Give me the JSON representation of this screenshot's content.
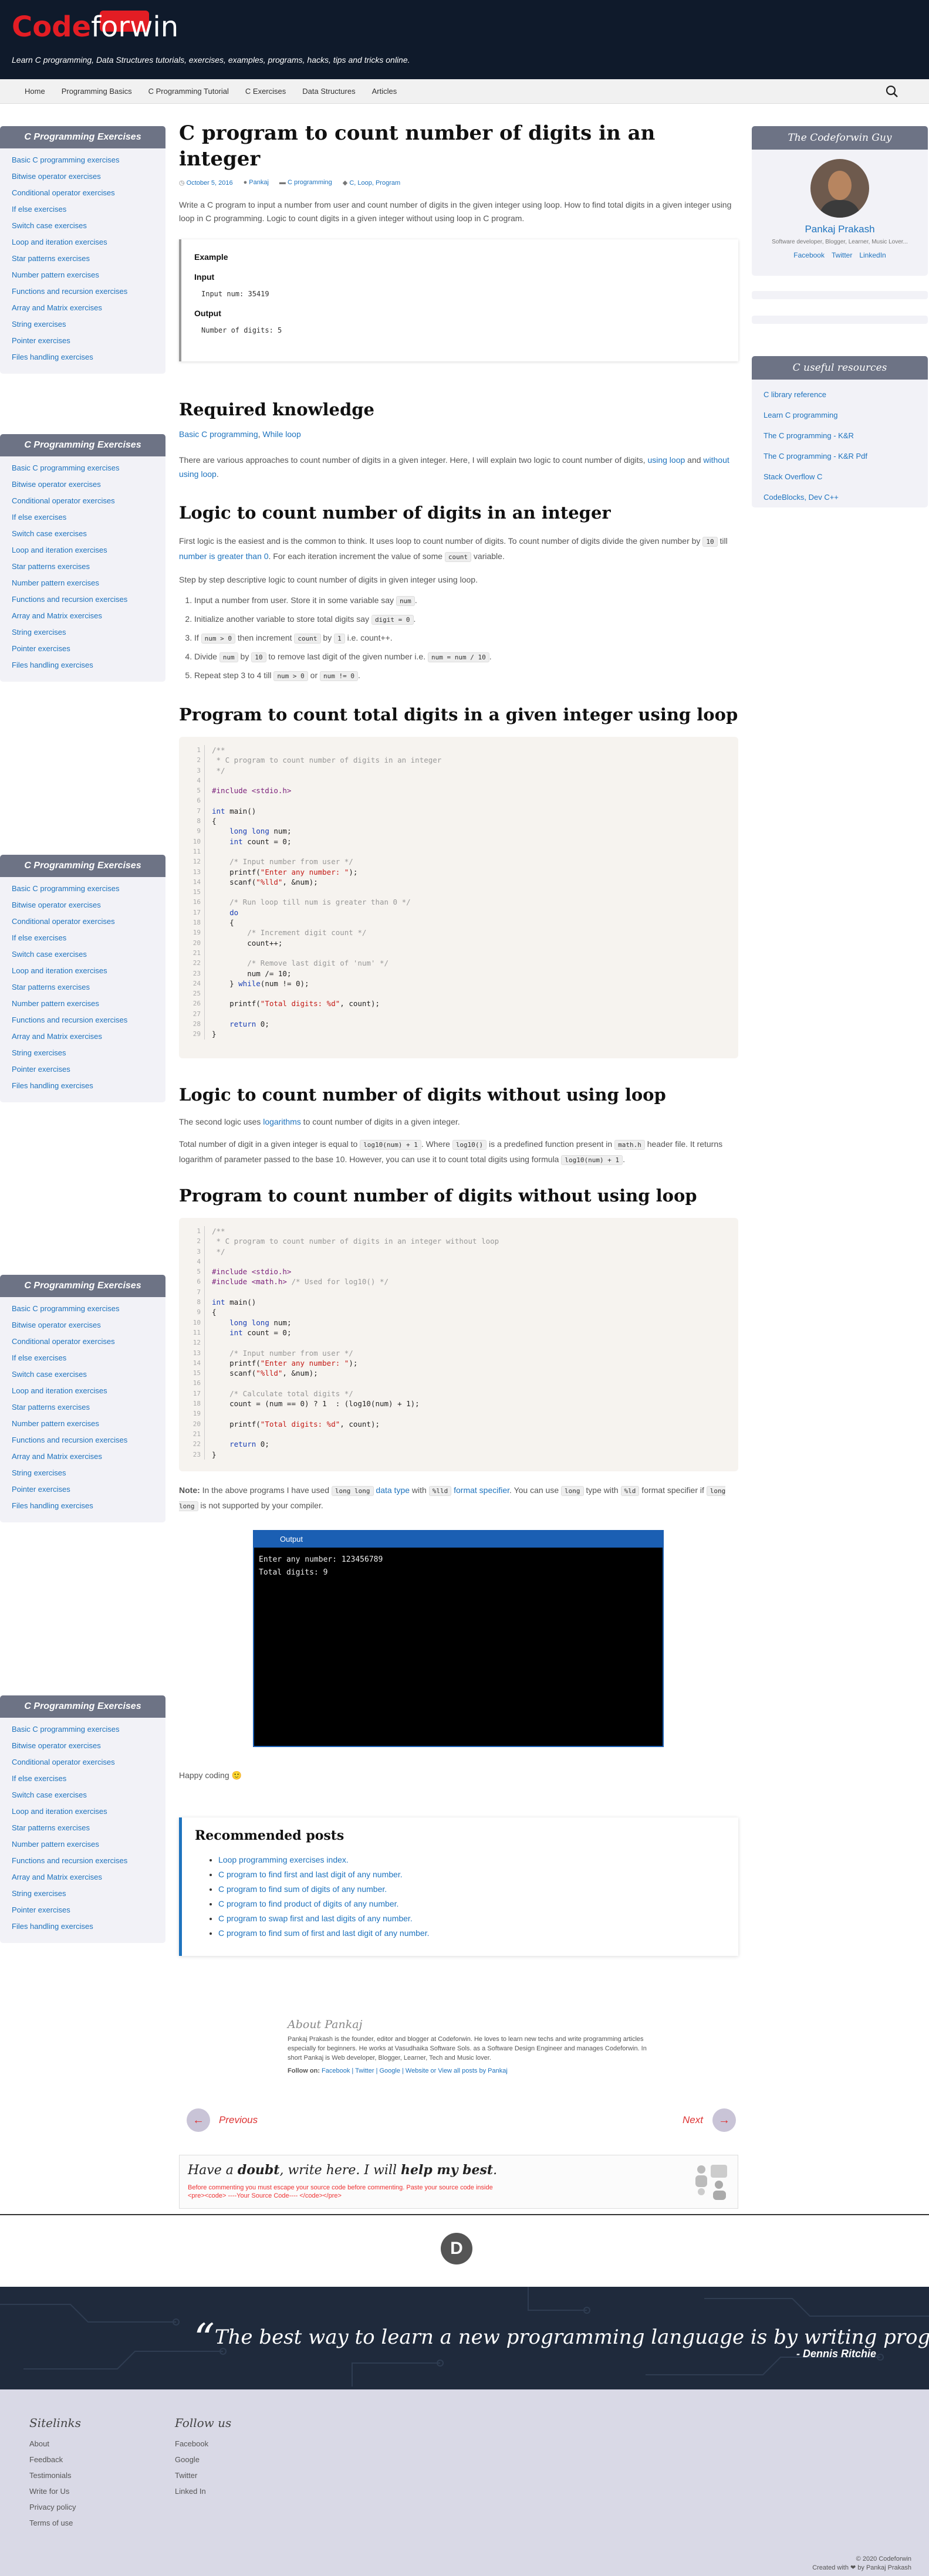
{
  "site": {
    "logo_a": "Code",
    "logo_b": "forwin",
    "tagline": "Learn C programming, Data Structures tutorials, exercises, examples, programs, hacks, tips and tricks online."
  },
  "nav": [
    "Home",
    "Programming Basics",
    "C Programming Tutorial",
    "C Exercises",
    "Data Structures",
    "Articles"
  ],
  "left_sidebar": {
    "title": "C Programming Exercises",
    "items": [
      "Basic C programming exercises",
      "Bitwise operator exercises",
      "Conditional operator exercises",
      "If else exercises",
      "Switch case exercises",
      "Loop and iteration exercises",
      "Star patterns exercises",
      "Number pattern exercises",
      "Functions and recursion exercises",
      "Array and Matrix exercises",
      "String exercises",
      "Pointer exercises",
      "Files handling exercises"
    ]
  },
  "right_sidebar": {
    "profile_title": "The Codeforwin Guy",
    "name": "Pankaj Prakash",
    "desc": "Software developer, Blogger, Learner, Music Lover...",
    "social": [
      "Facebook",
      "Twitter",
      "LinkedIn"
    ],
    "resources_title": "C useful resources",
    "resources": [
      "C library reference",
      "Learn C programming",
      "The C programming - K&R",
      "The C programming - K&R Pdf",
      "Stack Overflow C",
      "CodeBlocks, Dev C++"
    ]
  },
  "article": {
    "title": "C program to count number of digits in an integer",
    "date": "October 5, 2016",
    "author": "Pankaj",
    "category": "C programming",
    "tags": "C, Loop, Program",
    "intro": "Write a C program to input a number from user and count number of digits in the given integer using loop. How to find total digits in a given integer using loop in C programming. Logic to count digits in a given integer without using loop in C program.",
    "example": {
      "label": "Example",
      "input_label": "Input",
      "input": "Input num: 35419",
      "output_label": "Output",
      "output": "Number of digits: 5"
    },
    "req_title": "Required knowledge",
    "req_links": [
      "Basic C programming",
      "While loop"
    ],
    "approach": "There are various approaches to count number of digits in a given integer. Here, I will explain two logic to count number of digits, ",
    "approach_l1": "using loop",
    "approach_mid": " and ",
    "approach_l2": "without using loop",
    "approach_end": ".",
    "logic1_title": "Logic to count number of digits in an integer",
    "logic1_p1": "First logic is the easiest and is the common to think. It uses loop to count number of digits. To count number of digits divide the given number by ",
    "logic1_c1": "10",
    "logic1_p2": " till ",
    "logic1_l1": "number is greater than 0",
    "logic1_p3": ". For each iteration increment the value of some ",
    "logic1_c2": "count",
    "logic1_p4": " variable.",
    "logic1_steps_intro": "Step by step descriptive logic to count number of digits in given integer using loop.",
    "steps": [
      {
        "a": "Input a number from user. Store it in some variable say ",
        "c1": "num",
        "b": ".",
        "c2": "",
        "d": "",
        "c3": "",
        "e": ""
      },
      {
        "a": "Initialize another variable to store total digits say ",
        "c1": "digit = 0",
        "b": ".",
        "c2": "",
        "d": "",
        "c3": "",
        "e": ""
      },
      {
        "a": "If ",
        "c1": "num > 0",
        "b": " then increment ",
        "c2": "count",
        "d": " by ",
        "c3": "1",
        "e": " i.e. count++."
      },
      {
        "a": "Divide ",
        "c1": "num",
        "b": " by ",
        "c2": "10",
        "d": " to remove last digit of the given number i.e. ",
        "c3": "num = num / 10",
        "e": "."
      },
      {
        "a": "Repeat step 3 to 4 till ",
        "c1": "num > 0",
        "b": " or ",
        "c2": "num != 0",
        "d": ".",
        "c3": "",
        "e": ""
      }
    ],
    "prog1_title": "Program to count total digits in a given integer using loop",
    "logic2_title": "Logic to count number of digits without using loop",
    "logic2_p1a": "The second logic uses ",
    "logic2_l": "logarithms",
    "logic2_p1b": " to count number of digits in a given integer.",
    "logic2_p2a": "Total number of digit in a given integer is equal to ",
    "logic2_c1": "log10(num) + 1",
    "logic2_p2b": ". Where ",
    "logic2_c2": "log10()",
    "logic2_p2c": " is a predefined function present in ",
    "logic2_c3": "math.h",
    "logic2_p2d": " header file. It returns logarithm of parameter passed to the base 10. However, you can use it to count total digits using formula ",
    "logic2_c4": "log10(num) + 1",
    "logic2_p2e": ".",
    "prog2_title": "Program to count number of digits without using loop",
    "note_label": "Note:",
    "note_a": " In the above programs I have used ",
    "note_c1": "long long",
    "note_l1": "data type",
    "note_b": " with ",
    "note_c2": "%lld",
    "note_l2": "format specifier",
    "note_c": ". You can use ",
    "note_c3": "long",
    "note_d": " type with ",
    "note_c4": "%ld",
    "note_e": " format specifier if ",
    "note_c5": "long long",
    "note_f": " is not supported by your compiler.",
    "output_title": "Output",
    "output_lines": "Enter any number: 123456789\nTotal digits: 9",
    "happy": "Happy coding 🙂",
    "rec_title": "Recommended posts",
    "rec": [
      "Loop programming exercises index.",
      "C program to find first and last digit of any number.",
      "C program to find sum of digits of any number.",
      "C program to find product of digits of any number.",
      "C program to swap first and last digits of any number.",
      "C program to find sum of first and last digit of any number."
    ],
    "about_title": "About Pankaj",
    "about_text": "Pankaj Prakash is the founder, editor and blogger at Codeforwin. He loves to learn new techs and write programming articles especially for beginners. He works at Vasudhaika Software Sols. as a Software Design Engineer and manages Codeforwin. In short Pankaj is Web developer, Blogger, Learner, Tech and Music lover.",
    "follow_label": "Follow on:",
    "follow_links": "Facebook | Twitter | Google | Website or View all posts by Pankaj",
    "prev": "Previous",
    "next": "Next",
    "doubt_a": "Have a ",
    "doubt_b": "doubt",
    "doubt_c": ", write here. I will ",
    "doubt_d": "help my best",
    "doubt_line1": "Before commenting you must escape your source code before commenting. Paste your source code inside",
    "doubt_line2": "<pre><code> ----Your Source Code---- </code></pre>"
  },
  "quote": {
    "text": "The best way to learn a new programming language is by writing programs in it.",
    "author": "- Dennis Ritchie"
  },
  "footer": {
    "sitelinks_title": "Sitelinks",
    "sitelinks": [
      "About",
      "Feedback",
      "Testimonials",
      "Write for Us",
      "Privacy policy",
      "Terms of use"
    ],
    "follow_title": "Follow us",
    "follow": [
      "Facebook",
      "Google",
      "Twitter",
      "Linked In"
    ],
    "copy1": "© 2020 Codeforwin",
    "copy2": "Created with ❤ by Pankaj Prakash"
  },
  "colors": {
    "header": "#0f1a2b",
    "accent": "#1e73be",
    "brand_red": "#e31d24",
    "sidebar_title": "#6d7385",
    "terminal_bar": "#1b5fb3"
  },
  "icons": [
    "search-icon",
    "clock-icon",
    "user-icon",
    "folder-icon",
    "tag-icon",
    "arrow-left-icon",
    "arrow-right-icon",
    "quote-icon"
  ]
}
